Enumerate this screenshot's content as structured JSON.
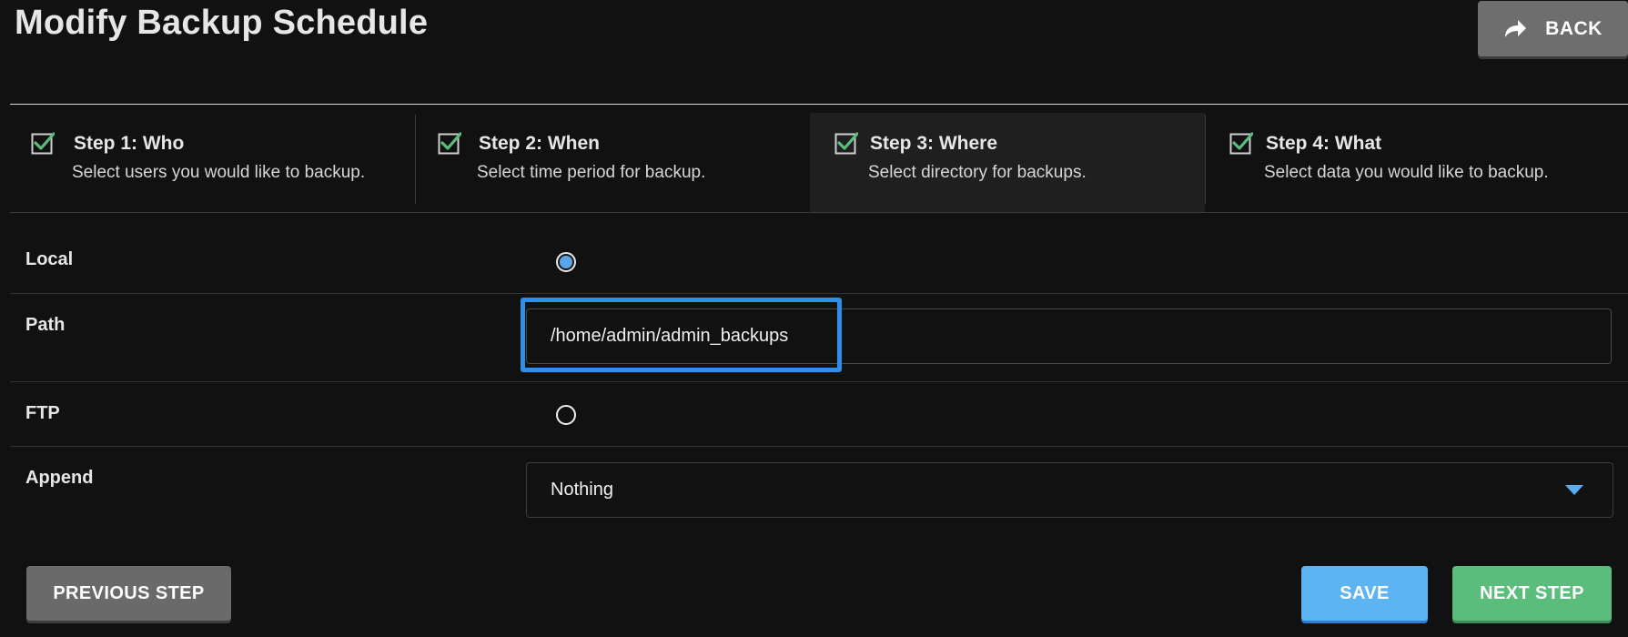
{
  "header": {
    "title": "Modify Backup Schedule",
    "back_label": "BACK"
  },
  "steps": [
    {
      "title": "Step 1: Who",
      "description": "Select users you would like to backup.",
      "completed": true,
      "active": false
    },
    {
      "title": "Step 2: When",
      "description": "Select time period for backup.",
      "completed": true,
      "active": false
    },
    {
      "title": "Step 3: Where",
      "description": "Select directory for backups.",
      "completed": true,
      "active": true
    },
    {
      "title": "Step 4: What",
      "description": "Select data you would like to backup.",
      "completed": true,
      "active": false
    }
  ],
  "form": {
    "local": {
      "label": "Local",
      "checked": true
    },
    "path": {
      "label": "Path",
      "value": "/home/admin/admin_backups"
    },
    "ftp": {
      "label": "FTP",
      "checked": false
    },
    "append": {
      "label": "Append",
      "selected": "Nothing"
    }
  },
  "buttons": {
    "previous": "PREVIOUS STEP",
    "save": "SAVE",
    "next": "NEXT STEP"
  },
  "colors": {
    "check": "#5bbd7c",
    "focus": "#2e8ee8",
    "save": "#5cb4f2",
    "next": "#5bbd7c",
    "secondary": "#6a6a6a"
  }
}
